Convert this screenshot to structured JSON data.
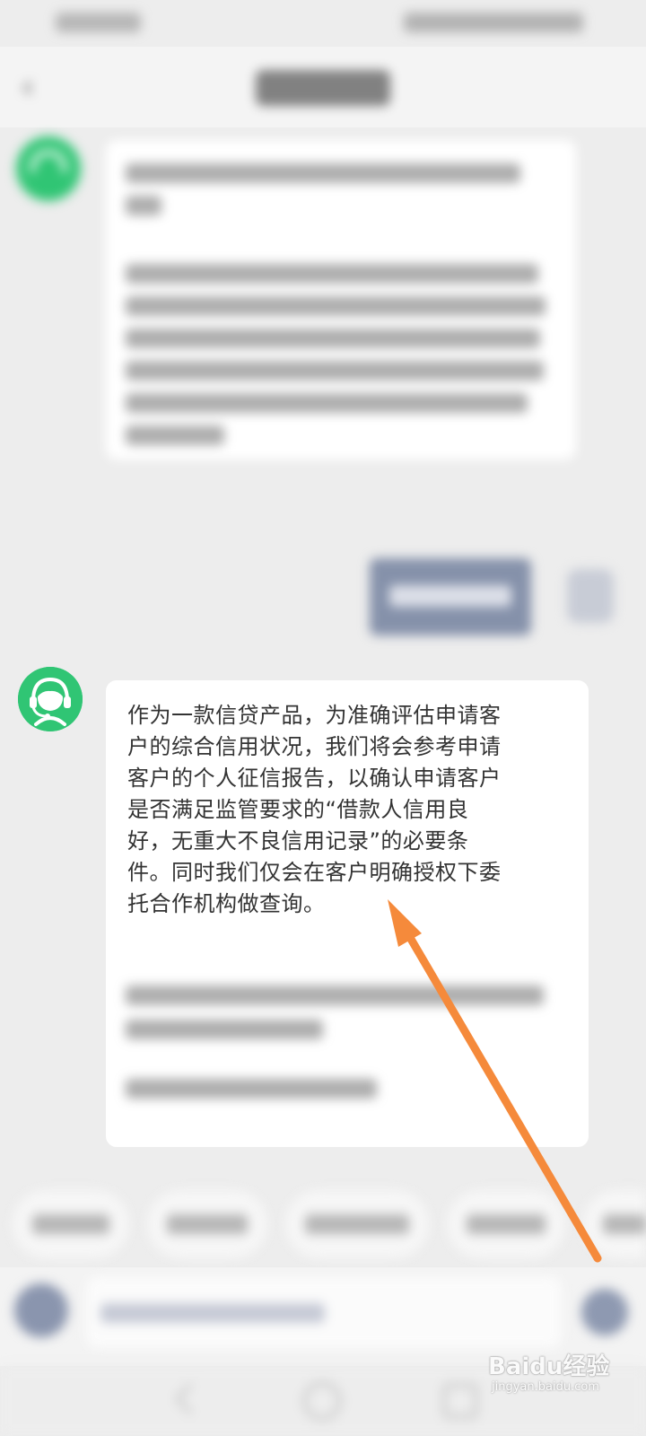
{
  "message": {
    "text": "作为一款信贷产品，为准确评估申请客户的综合信用状况，我们将会参考申请客户的个人征信报告，以确认申请客户是否满足监管要求的“借款人信用良好，无重大不良信用记录”的必要条件。同时我们仅会在客户明确授权下委托合作机构做查询。",
    "lines": [
      "作为一款信贷产品，为准确评估申请客",
      "户的综合信用状况，我们将会参考申请",
      "客户的个人征信报告，以确认申请客户",
      "是否满足监管要求的“借款人信用良",
      "好，无重大不良信用记录”的必要条",
      "件。同时我们仅会在客户明确授权下委",
      "托合作机构做查询。"
    ]
  },
  "icons": {
    "avatar": "headset-agent-icon",
    "back": "back-arrow-icon",
    "voice": "voice-icon",
    "send": "send-icon",
    "annotation": "orange-arrow-annotation"
  },
  "colors": {
    "accent_green": "#30c574",
    "annotation_orange": "#f58a3b",
    "user_bubble": "#8591aa"
  },
  "watermark": {
    "brand": "Baidu经验",
    "url": "jingyan.baidu.com"
  }
}
